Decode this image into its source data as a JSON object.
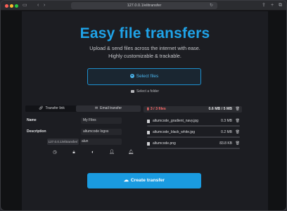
{
  "browser": {
    "url": "127.0.0.1/elitransfer"
  },
  "hero": {
    "title": "Easy file transfers",
    "subtitle_line1": "Upload & send files across the internet with ease.",
    "subtitle_line2": "Highly customizable & trackable."
  },
  "upload": {
    "select_files_label": "Select files",
    "select_folder_label": "Select a folder"
  },
  "tabs": [
    {
      "label": "Transfer link",
      "active": true
    },
    {
      "label": "Email transfer",
      "active": false
    }
  ],
  "form": {
    "name_label": "Name",
    "name_value": "My Files",
    "description_label": "Description",
    "description_value": "altumcode logos",
    "url_prefix": "127.0.0.1/elitransfer/",
    "url_value": "alun"
  },
  "options_icons": [
    "clock-icon",
    "lock-icon",
    "contrast-icon",
    "user-icon",
    "bell-icon"
  ],
  "files": {
    "count_label": "3 / 3 files",
    "total_label": "0.6 MB / 5 MB",
    "items": [
      {
        "name": "altumcode_gradient_navy.jpg",
        "size": "0.3 MB"
      },
      {
        "name": "altumcode_black_white.jpg",
        "size": "0.2 MB"
      },
      {
        "name": "altumcode.png",
        "size": "83.8 KB"
      }
    ]
  },
  "actions": {
    "create_label": "Create transfer"
  },
  "colors": {
    "accent": "#1fa3e8",
    "button": "#1a9be0",
    "warning": "#ff6b6b"
  }
}
